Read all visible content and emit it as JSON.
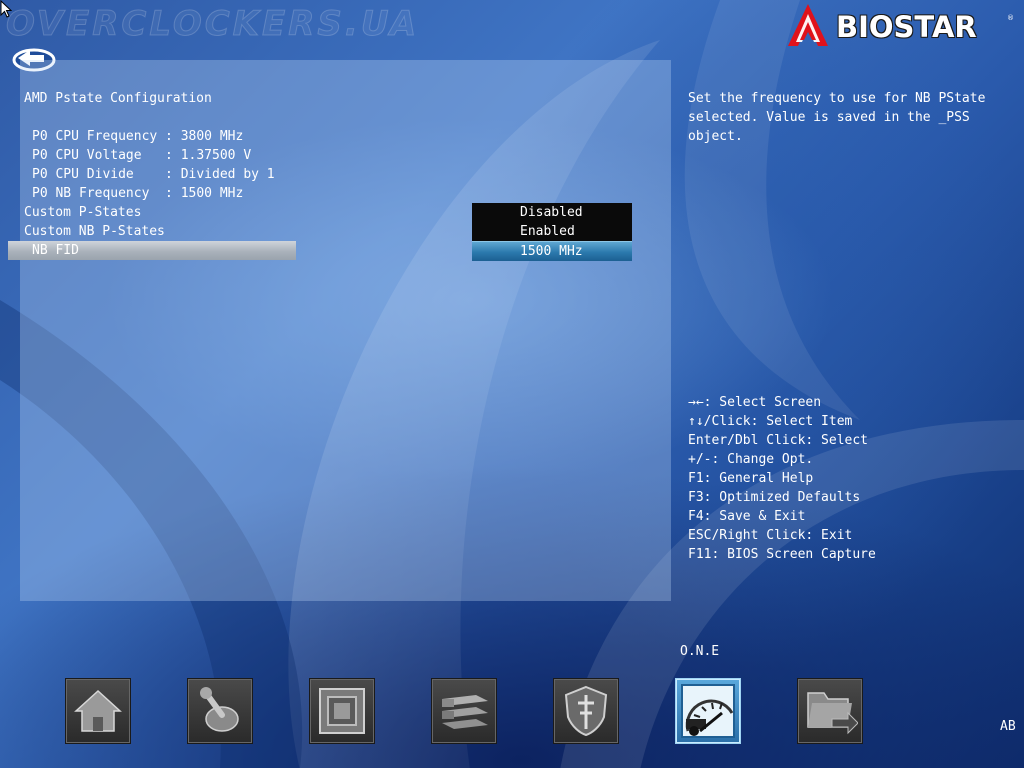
{
  "watermark": "OVERCLOCKERS.UA",
  "brand": {
    "name": "BIOSTAR",
    "reg": "®",
    "accent": "#e0121b"
  },
  "page": {
    "title": "AMD Pstate Configuration",
    "info": [
      "P0 CPU Frequency : 3800 MHz",
      "P0 CPU Voltage   : 1.37500 V",
      "P0 CPU Divide    : Divided by 1",
      "P0 NB Frequency  : 1500 MHz"
    ],
    "settings": [
      {
        "label": "Custom P-States",
        "value": "Disabled"
      },
      {
        "label": "Custom NB P-States",
        "value": "Enabled"
      },
      {
        "label": "NB FID",
        "value": "1500 MHz",
        "selected": true
      }
    ]
  },
  "help": {
    "lines": [
      "Set the frequency to use for NB PState",
      "selected. Value is saved in the _PSS",
      "object."
    ]
  },
  "keys": [
    "→←: Select Screen",
    "↑↓/Click: Select Item",
    "Enter/Dbl Click: Select",
    "+/-: Change Opt.",
    "F1: General Help",
    "F3: Optimized Defaults",
    "F4: Save & Exit",
    "ESC/Right Click: Exit",
    "F11: BIOS Screen Capture"
  ],
  "nav": {
    "active_label": "O.N.E",
    "corner": "AB",
    "icons": [
      "home-icon",
      "joystick-icon",
      "chip-icon",
      "drives-icon",
      "security-shield-icon",
      "speedometer-icon",
      "exit-folder-icon"
    ]
  },
  "colors": {
    "selected_value": "#2b79ad",
    "value_bg": "#0a0a0a",
    "panel": "#b8d0ef"
  }
}
